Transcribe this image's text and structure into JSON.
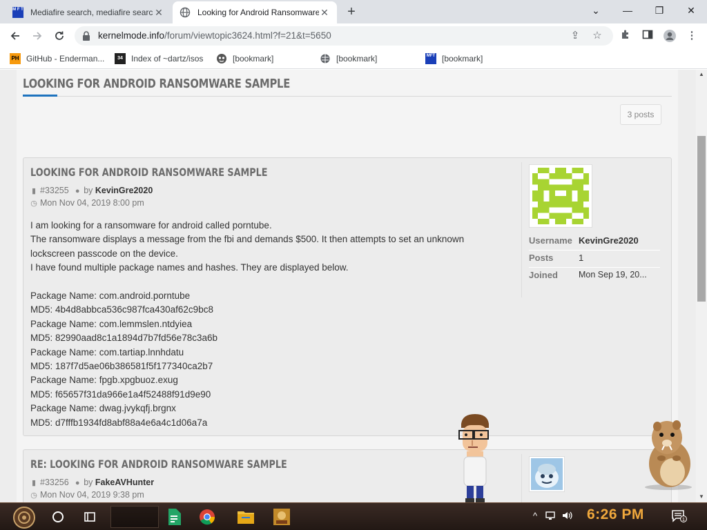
{
  "browser": {
    "tabs": [
      {
        "title": "Mediafire search, mediafire search",
        "close": "✕",
        "active": false
      },
      {
        "title": "Looking for Android Ransomware",
        "close": "✕",
        "active": true
      }
    ],
    "new_tab": "+",
    "window_controls": {
      "minimize": "—",
      "maximize": "❐",
      "close": "✕",
      "dropdown": "⌄"
    },
    "url": {
      "domain": "kernelmode.info",
      "path": "/forum/viewtopic3624.html?f=21&t=5650"
    },
    "bookmarks": [
      {
        "icon_text": "PH",
        "label": "GitHub - Enderman..."
      },
      {
        "icon_text": "34",
        "label": "Index of ~dartz/isos"
      },
      {
        "icon_text": "",
        "label": "[bookmark]"
      },
      {
        "icon_text": "",
        "label": "[bookmark]"
      },
      {
        "icon_text": "MFT",
        "label": "[bookmark]"
      }
    ]
  },
  "page": {
    "topic_title": "LOOKING FOR ANDROID RANSOMWARE SAMPLE",
    "posts_count": "3 posts",
    "posts": [
      {
        "title": "LOOKING FOR ANDROID RANSOMWARE SAMPLE",
        "id": "#33255",
        "by": "by",
        "author": "KevinGre2020",
        "date": "Mon Nov 04, 2019 8:00 pm",
        "lines": [
          "I am looking for a ransomware for android called porntube.",
          "The ransomware displays a message from the fbi and demands $500. It then attempts to set an unknown",
          "lockscreen passcode on the device.",
          "I have found multiple package names and hashes. They are displayed below.",
          "",
          "Package Name: com.android.porntube",
          "MD5: 4b4d8abbca536c987fca430af62c9bc8",
          "Package Name: com.lemmslen.ntdyiea",
          "MD5: 82990aad8c1a1894d7b7fd56e78c3a6b",
          "Package Name: com.tartiap.lnnhdatu",
          "MD5: 187f7d5ae06b386581f5f177340ca2b7",
          "Package Name: fpgb.xpgbuoz.exug",
          "MD5: f65657f31da966e1a4f52488f91d9e90",
          "Package Name: dwag.jvykqfj.brgnx",
          "MD5: d7fffb1934fd8abf88a4e6a4c1d06a7a"
        ],
        "profile": {
          "username_label": "Username",
          "username": "KevinGre2020",
          "posts_label": "Posts",
          "posts": "1",
          "joined_label": "Joined",
          "joined": "Mon Sep 19, 20..."
        }
      },
      {
        "title": "RE: LOOKING FOR ANDROID RANSOMWARE SAMPLE",
        "id": "#33256",
        "by": "by",
        "author": "FakeAVHunter",
        "date": "Mon Nov 04, 2019 9:38 pm"
      }
    ]
  },
  "taskbar": {
    "clock": "6:26 PM",
    "notification_count": "1"
  },
  "colors": {
    "accent": "#1e73be",
    "avatar_green": "#a8d432",
    "clock": "#f0a83c"
  }
}
